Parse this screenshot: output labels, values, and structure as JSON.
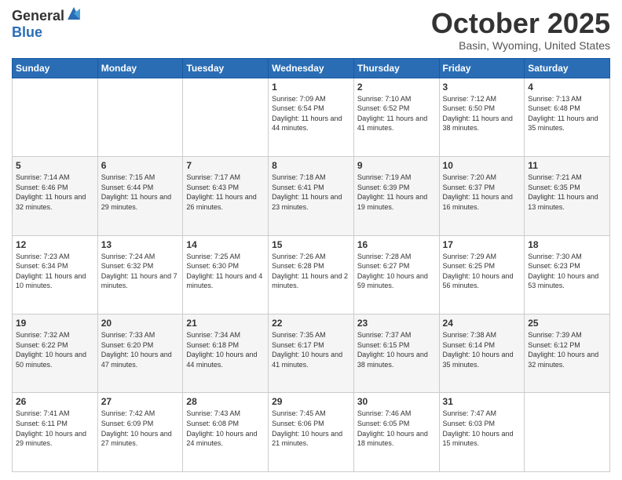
{
  "logo": {
    "general": "General",
    "blue": "Blue"
  },
  "header": {
    "month": "October 2025",
    "location": "Basin, Wyoming, United States"
  },
  "days_of_week": [
    "Sunday",
    "Monday",
    "Tuesday",
    "Wednesday",
    "Thursday",
    "Friday",
    "Saturday"
  ],
  "weeks": [
    [
      {
        "day": "",
        "info": ""
      },
      {
        "day": "",
        "info": ""
      },
      {
        "day": "",
        "info": ""
      },
      {
        "day": "1",
        "info": "Sunrise: 7:09 AM\nSunset: 6:54 PM\nDaylight: 11 hours and 44 minutes."
      },
      {
        "day": "2",
        "info": "Sunrise: 7:10 AM\nSunset: 6:52 PM\nDaylight: 11 hours and 41 minutes."
      },
      {
        "day": "3",
        "info": "Sunrise: 7:12 AM\nSunset: 6:50 PM\nDaylight: 11 hours and 38 minutes."
      },
      {
        "day": "4",
        "info": "Sunrise: 7:13 AM\nSunset: 6:48 PM\nDaylight: 11 hours and 35 minutes."
      }
    ],
    [
      {
        "day": "5",
        "info": "Sunrise: 7:14 AM\nSunset: 6:46 PM\nDaylight: 11 hours and 32 minutes."
      },
      {
        "day": "6",
        "info": "Sunrise: 7:15 AM\nSunset: 6:44 PM\nDaylight: 11 hours and 29 minutes."
      },
      {
        "day": "7",
        "info": "Sunrise: 7:17 AM\nSunset: 6:43 PM\nDaylight: 11 hours and 26 minutes."
      },
      {
        "day": "8",
        "info": "Sunrise: 7:18 AM\nSunset: 6:41 PM\nDaylight: 11 hours and 23 minutes."
      },
      {
        "day": "9",
        "info": "Sunrise: 7:19 AM\nSunset: 6:39 PM\nDaylight: 11 hours and 19 minutes."
      },
      {
        "day": "10",
        "info": "Sunrise: 7:20 AM\nSunset: 6:37 PM\nDaylight: 11 hours and 16 minutes."
      },
      {
        "day": "11",
        "info": "Sunrise: 7:21 AM\nSunset: 6:35 PM\nDaylight: 11 hours and 13 minutes."
      }
    ],
    [
      {
        "day": "12",
        "info": "Sunrise: 7:23 AM\nSunset: 6:34 PM\nDaylight: 11 hours and 10 minutes."
      },
      {
        "day": "13",
        "info": "Sunrise: 7:24 AM\nSunset: 6:32 PM\nDaylight: 11 hours and 7 minutes."
      },
      {
        "day": "14",
        "info": "Sunrise: 7:25 AM\nSunset: 6:30 PM\nDaylight: 11 hours and 4 minutes."
      },
      {
        "day": "15",
        "info": "Sunrise: 7:26 AM\nSunset: 6:28 PM\nDaylight: 11 hours and 2 minutes."
      },
      {
        "day": "16",
        "info": "Sunrise: 7:28 AM\nSunset: 6:27 PM\nDaylight: 10 hours and 59 minutes."
      },
      {
        "day": "17",
        "info": "Sunrise: 7:29 AM\nSunset: 6:25 PM\nDaylight: 10 hours and 56 minutes."
      },
      {
        "day": "18",
        "info": "Sunrise: 7:30 AM\nSunset: 6:23 PM\nDaylight: 10 hours and 53 minutes."
      }
    ],
    [
      {
        "day": "19",
        "info": "Sunrise: 7:32 AM\nSunset: 6:22 PM\nDaylight: 10 hours and 50 minutes."
      },
      {
        "day": "20",
        "info": "Sunrise: 7:33 AM\nSunset: 6:20 PM\nDaylight: 10 hours and 47 minutes."
      },
      {
        "day": "21",
        "info": "Sunrise: 7:34 AM\nSunset: 6:18 PM\nDaylight: 10 hours and 44 minutes."
      },
      {
        "day": "22",
        "info": "Sunrise: 7:35 AM\nSunset: 6:17 PM\nDaylight: 10 hours and 41 minutes."
      },
      {
        "day": "23",
        "info": "Sunrise: 7:37 AM\nSunset: 6:15 PM\nDaylight: 10 hours and 38 minutes."
      },
      {
        "day": "24",
        "info": "Sunrise: 7:38 AM\nSunset: 6:14 PM\nDaylight: 10 hours and 35 minutes."
      },
      {
        "day": "25",
        "info": "Sunrise: 7:39 AM\nSunset: 6:12 PM\nDaylight: 10 hours and 32 minutes."
      }
    ],
    [
      {
        "day": "26",
        "info": "Sunrise: 7:41 AM\nSunset: 6:11 PM\nDaylight: 10 hours and 29 minutes."
      },
      {
        "day": "27",
        "info": "Sunrise: 7:42 AM\nSunset: 6:09 PM\nDaylight: 10 hours and 27 minutes."
      },
      {
        "day": "28",
        "info": "Sunrise: 7:43 AM\nSunset: 6:08 PM\nDaylight: 10 hours and 24 minutes."
      },
      {
        "day": "29",
        "info": "Sunrise: 7:45 AM\nSunset: 6:06 PM\nDaylight: 10 hours and 21 minutes."
      },
      {
        "day": "30",
        "info": "Sunrise: 7:46 AM\nSunset: 6:05 PM\nDaylight: 10 hours and 18 minutes."
      },
      {
        "day": "31",
        "info": "Sunrise: 7:47 AM\nSunset: 6:03 PM\nDaylight: 10 hours and 15 minutes."
      },
      {
        "day": "",
        "info": ""
      }
    ]
  ]
}
